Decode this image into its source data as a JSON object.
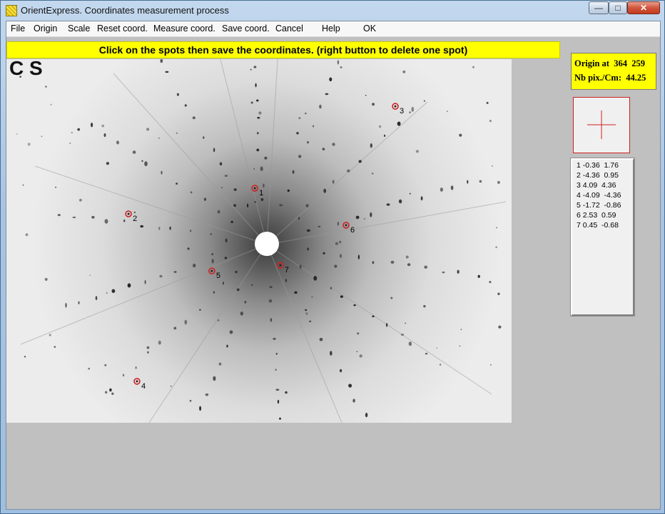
{
  "window": {
    "title": "OrientExpress. Coordinates measurement process",
    "controls": {
      "minimize": "—",
      "maximize": "□",
      "close": "✕"
    }
  },
  "menu": [
    {
      "id": "file",
      "label": "File"
    },
    {
      "id": "origin",
      "label": "Origin"
    },
    {
      "id": "scale",
      "label": "Scale"
    },
    {
      "id": "reset",
      "label": "Reset coord."
    },
    {
      "id": "measure",
      "label": "Measure coord."
    },
    {
      "id": "save",
      "label": "Save coord."
    },
    {
      "id": "cancel",
      "label": "Cancel"
    },
    {
      "id": "help",
      "label": "Help"
    },
    {
      "id": "ok",
      "label": "OK"
    }
  ],
  "banner": "Click on the spots then save the coordinates. (right button to delete one spot)",
  "info": {
    "origin_label": "Origin at",
    "origin_x": "364",
    "origin_y": "259",
    "scale_label": "Nb pix./Cm:",
    "scale_value": "44.25"
  },
  "image_label": "C S",
  "spots": [
    {
      "n": "1",
      "x": "-0.36",
      "y": "1.76"
    },
    {
      "n": "2",
      "x": "-4.36",
      "y": "0.95"
    },
    {
      "n": "3",
      "x": "4.09",
      "y": "4.36"
    },
    {
      "n": "4",
      "x": "-4.09",
      "y": "-4.36"
    },
    {
      "n": "5",
      "x": "-1.72",
      "y": "-0.86"
    },
    {
      "n": "6",
      "x": "2.53",
      "y": "0.59"
    },
    {
      "n": "7",
      "x": "0.45",
      "y": "-0.68"
    }
  ],
  "colors": {
    "banner": "#ffff00",
    "marker": "#d02020",
    "info_box": "#ffff00"
  }
}
